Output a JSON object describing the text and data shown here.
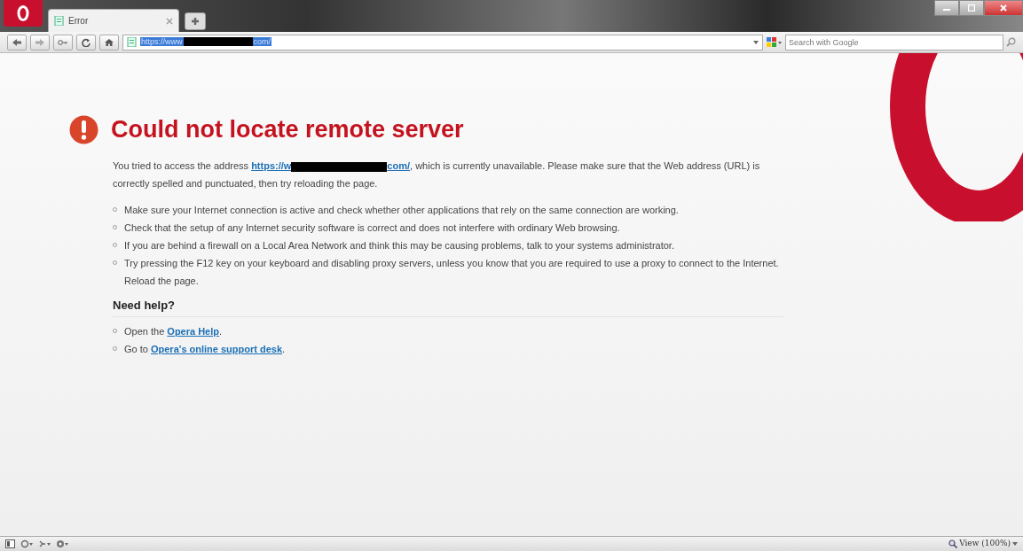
{
  "tabs": [
    {
      "title": "Error",
      "selected": true
    }
  ],
  "address_bar": {
    "url_start": "https://www",
    "url_end": "com/"
  },
  "search": {
    "placeholder": "Search with Google"
  },
  "error_page": {
    "heading": "Could not locate remote server",
    "intro": {
      "before": "You tried to access the address ",
      "link_start": "https://w",
      "link_end": "com/",
      "after": ", which is currently unavailable. Please make sure that the Web address (URL) is correctly spelled and punctuated, then try reloading the page."
    },
    "tips": [
      "Make sure your Internet connection is active and check whether other applications that rely on the same connection are working.",
      "Check that the setup of any Internet security software is correct and does not interfere with ordinary Web browsing.",
      "If you are behind a firewall on a Local Area Network and think this may be causing problems, talk to your systems administrator.",
      "Try pressing the F12 key on your keyboard and disabling proxy servers, unless you know that you are required to use a proxy to connect to the Internet. Reload the page."
    ],
    "help_heading": "Need help?",
    "help_items": [
      {
        "before": "Open the ",
        "link": "Opera Help",
        "after": "."
      },
      {
        "before": "Go to ",
        "link": "Opera's online support desk",
        "after": "."
      }
    ]
  },
  "status_bar": {
    "zoom": "View (100%)"
  }
}
